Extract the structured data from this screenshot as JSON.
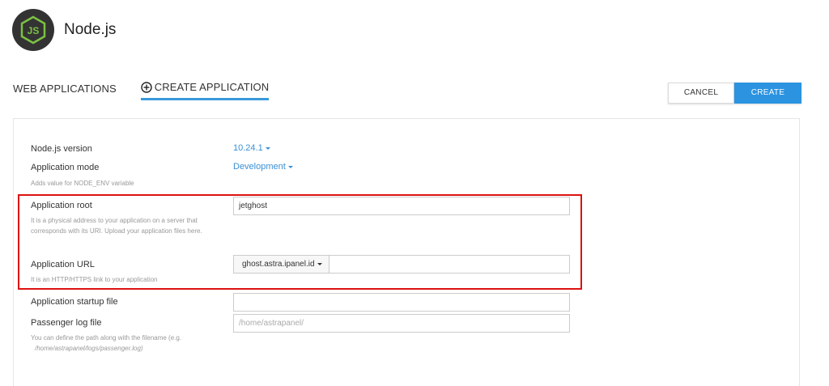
{
  "header": {
    "title": "Node.js",
    "logo_icon": "nodejs-logo-icon"
  },
  "tabs": [
    {
      "label": "WEB APPLICATIONS"
    },
    {
      "label": "CREATE APPLICATION",
      "icon": "plus-circle-icon"
    }
  ],
  "actions": {
    "cancel": "CANCEL",
    "create": "CREATE"
  },
  "form": {
    "nodejs_version": {
      "label": "Node.js version",
      "value": "10.24.1"
    },
    "app_mode": {
      "label": "Application mode",
      "value": "Development",
      "hint": "Adds value for NODE_ENV variable"
    },
    "app_root": {
      "label": "Application root",
      "value": "jetghost",
      "hint": "It is a physical address to your application on a server that corresponds with its URI. Upload your application files here."
    },
    "app_url": {
      "label": "Application URL",
      "domain": "ghost.astra.ipanel.id",
      "value": "",
      "hint": "It is an HTTP/HTTPS link to your application"
    },
    "startup_file": {
      "label": "Application startup file",
      "value": ""
    },
    "passenger_log": {
      "label": "Passenger log file",
      "placeholder": "/home/astrapanel/",
      "hint": "You can define the path along with the filename (e.g.",
      "hint_example": "/home/astrapanel/logs/passenger.log)"
    }
  },
  "colors": {
    "accent": "#2b93e0",
    "highlight": "#dd1111",
    "logo_bg": "#333333",
    "logo_green": "#7cc142"
  }
}
